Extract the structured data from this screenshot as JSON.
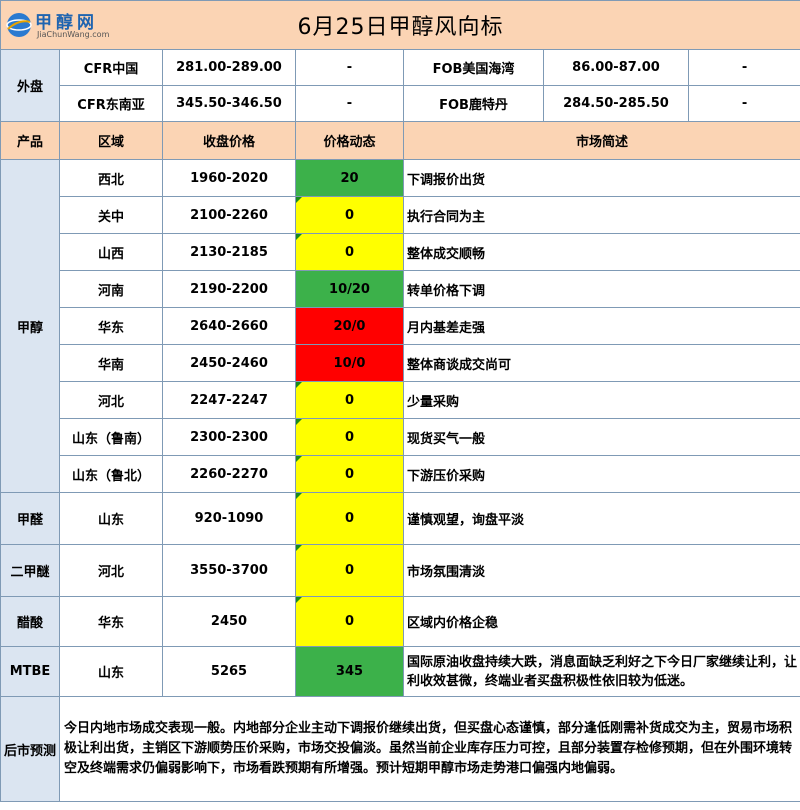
{
  "title": "6月25日甲醇风向标",
  "logo": {
    "text": "甲醇网",
    "url": "JiaChunWang.com"
  },
  "foreign": {
    "label": "外盘",
    "rows": [
      {
        "left_name": "CFR中国",
        "left_price": "281.00-289.00",
        "left_change": "-",
        "right_name": "FOB美国海湾",
        "right_price": "86.00-87.00",
        "right_change": "-"
      },
      {
        "left_name": "CFR东南亚",
        "left_price": "345.50-346.50",
        "left_change": "-",
        "right_name": "FOB鹿特丹",
        "right_price": "284.50-285.50",
        "right_change": "-"
      }
    ]
  },
  "headers": {
    "product": "产品",
    "region": "区域",
    "price": "收盘价格",
    "change": "价格动态",
    "summary": "市场简述"
  },
  "methanol": {
    "product": "甲醇",
    "rows": [
      {
        "region": "西北",
        "price": "1960-2020",
        "change": "20",
        "status": "green",
        "note": "下调报价出货"
      },
      {
        "region": "关中",
        "price": "2100-2260",
        "change": "0",
        "status": "yellow",
        "note": "执行合同为主"
      },
      {
        "region": "山西",
        "price": "2130-2185",
        "change": "0",
        "status": "yellow",
        "note": "整体成交顺畅"
      },
      {
        "region": "河南",
        "price": "2190-2200",
        "change": "10/20",
        "status": "green",
        "note": "转单价格下调"
      },
      {
        "region": "华东",
        "price": "2640-2660",
        "change": "20/0",
        "status": "red",
        "note": "月内基差走强"
      },
      {
        "region": "华南",
        "price": "2450-2460",
        "change": "10/0",
        "status": "red",
        "note": "整体商谈成交尚可"
      },
      {
        "region": "河北",
        "price": "2247-2247",
        "change": "0",
        "status": "yellow",
        "note": "少量采购"
      },
      {
        "region": "山东（鲁南）",
        "price": "2300-2300",
        "change": "0",
        "status": "yellow",
        "note": "现货买气一般"
      },
      {
        "region": "山东（鲁北）",
        "price": "2260-2270",
        "change": "0",
        "status": "yellow",
        "note": "下游压价采购"
      }
    ]
  },
  "others": [
    {
      "product": "甲醛",
      "region": "山东",
      "price": "920-1090",
      "change": "0",
      "status": "yellow",
      "note": "谨慎观望，询盘平淡"
    },
    {
      "product": "二甲醚",
      "region": "河北",
      "price": "3550-3700",
      "change": "0",
      "status": "yellow",
      "note": "市场氛围清淡"
    },
    {
      "product": "醋酸",
      "region": "华东",
      "price": "2450",
      "change": "0",
      "status": "yellow",
      "note": "区域内价格企稳"
    },
    {
      "product": "MTBE",
      "region": "山东",
      "price": "5265",
      "change": "345",
      "status": "green",
      "note": "国际原油收盘持续大跌，消息面缺乏利好之下今日厂家继续让利，让利收效甚微，终端业者买盘积极性依旧较为低迷。"
    }
  ],
  "forecast": {
    "label": "后市预测",
    "text": "今日内地市场成交表现一般。内地部分企业主动下调报价继续出货，但买盘心态谨慎，部分逢低刚需补货成交为主，贸易市场积极让利出货，主销区下游顺势压价采购，市场交投偏淡。虽然当前企业库存压力可控，且部分装置存检修预期，但在外围环境转空及终端需求仍偏弱影响下，市场看跌预期有所增强。预计短期甲醇市场走势港口偏强内地偏弱。"
  },
  "colors": {
    "green": "#3cb14a",
    "yellow": "#ffff00",
    "red": "#ff0000",
    "header": "#fbd4b4",
    "side": "#dbe5f1"
  }
}
